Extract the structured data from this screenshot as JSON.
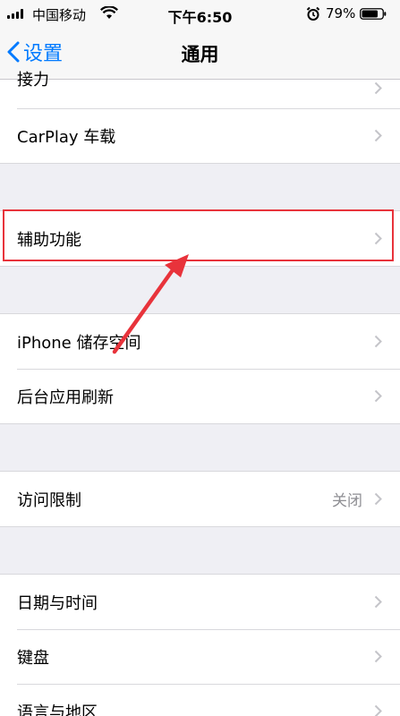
{
  "status_bar": {
    "carrier": "中国移动",
    "time": "下午6:50",
    "battery": "79%"
  },
  "nav": {
    "back_label": "设置",
    "title": "通用"
  },
  "groups": [
    {
      "items": [
        {
          "label": "接力"
        },
        {
          "label": "CarPlay 车载"
        }
      ]
    },
    {
      "items": [
        {
          "label": "辅助功能"
        }
      ]
    },
    {
      "items": [
        {
          "label": "iPhone 储存空间"
        },
        {
          "label": "后台应用刷新"
        }
      ]
    },
    {
      "items": [
        {
          "label": "访问限制",
          "value": "关闭"
        }
      ]
    },
    {
      "items": [
        {
          "label": "日期与时间"
        },
        {
          "label": "键盘"
        },
        {
          "label": "语言与地区"
        }
      ]
    }
  ],
  "colors": {
    "accent": "#007aff",
    "highlight": "#e8333b"
  },
  "icons": {
    "back": "chevron-left-icon",
    "disclosure": "chevron-right-icon"
  }
}
